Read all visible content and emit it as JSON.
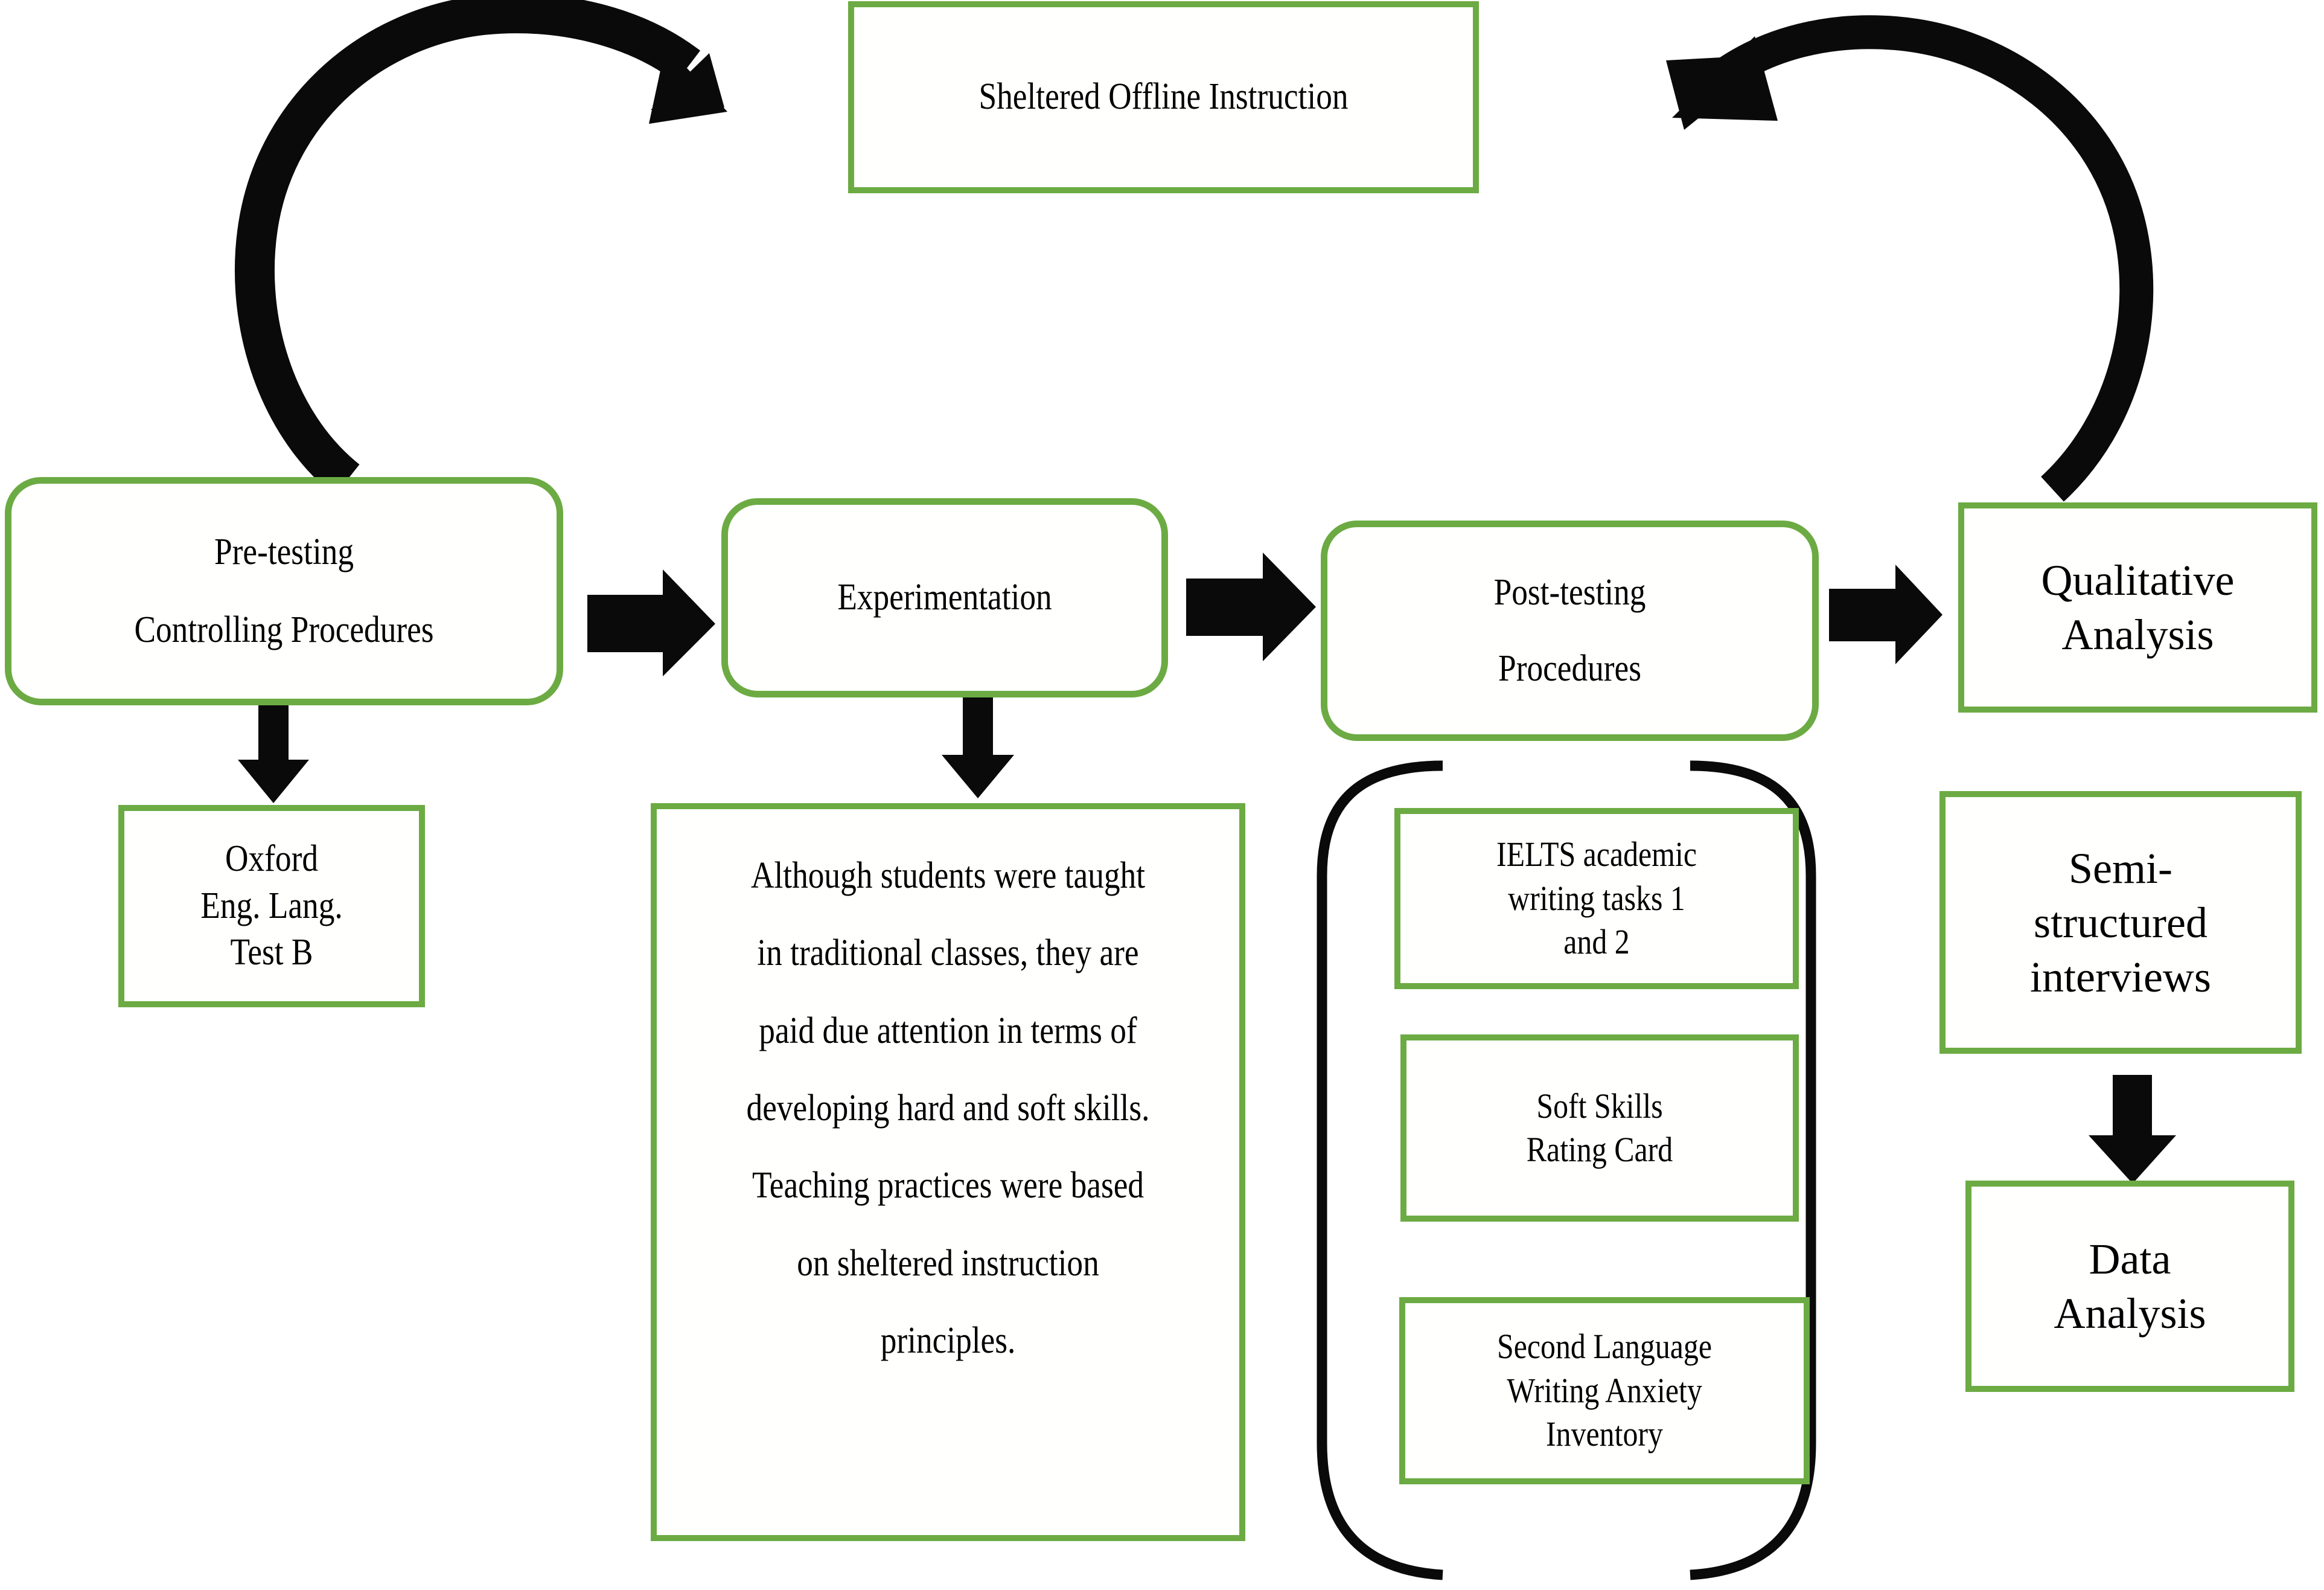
{
  "diagram": {
    "title": "Research design flow diagram",
    "accent_color": "#6CAB43",
    "arrow_color": "#000000",
    "background": "#FFFFFF"
  },
  "nodes": {
    "sheltered_instruction": {
      "label": "Sheltered Offline Instruction"
    },
    "pre_testing": {
      "line1": "Pre-testing",
      "line2": "Controlling Procedures"
    },
    "oxford_test": {
      "line1": "Oxford",
      "line2": "Eng. Lang.",
      "line3": "Test B"
    },
    "experimentation": {
      "label": "Experimentation"
    },
    "experimentation_note": {
      "text": "Although students were taught in traditional classes, they are paid due attention in terms of developing hard and soft skills. Teaching practices were based on sheltered instruction principles."
    },
    "post_testing": {
      "line1": "Post-testing",
      "line2": "Procedures"
    },
    "ielts": {
      "line1": "IELTS academic",
      "line2": "writing tasks 1",
      "line3": "and 2"
    },
    "soft_skills": {
      "line1": "Soft Skills",
      "line2": "Rating Card"
    },
    "swai": {
      "line1": "Second Language",
      "line2": "Writing Anxiety",
      "line3": "Inventory"
    },
    "qualitative_analysis": {
      "line1": "Qualitative",
      "line2": "Analysis"
    },
    "semi_structured": {
      "line1": "Semi-",
      "line2": "structured",
      "line3": "interviews"
    },
    "data_analysis": {
      "line1": "Data",
      "line2": "Analysis"
    }
  },
  "connectors": [
    {
      "name": "curved-arrow-pretesting-to-instruction",
      "kind": "curved-arrow",
      "direction": "clockwise-up-right"
    },
    {
      "name": "curved-arrow-qualitative-to-instruction",
      "kind": "curved-arrow",
      "direction": "counterclockwise-up-left"
    },
    {
      "name": "arrow-pretesting-to-experimentation",
      "kind": "block-arrow-right"
    },
    {
      "name": "arrow-experimentation-to-posttesting",
      "kind": "block-arrow-right"
    },
    {
      "name": "arrow-posttesting-to-qualitative",
      "kind": "block-arrow-right"
    },
    {
      "name": "arrow-pretesting-to-oxford",
      "kind": "block-arrow-down"
    },
    {
      "name": "arrow-experimentation-to-note",
      "kind": "block-arrow-down"
    },
    {
      "name": "arrow-semistructured-to-dataanalysis",
      "kind": "block-arrow-down"
    },
    {
      "name": "bracket-posttesting-instruments",
      "kind": "rounded-bracket"
    }
  ]
}
